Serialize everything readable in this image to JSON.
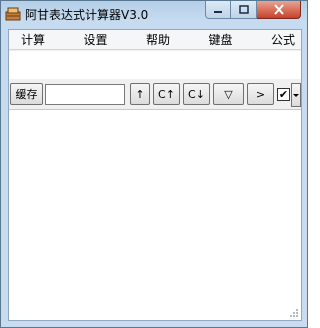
{
  "window": {
    "title": "阿甘表达式计算器V3.0",
    "icons": {
      "app": "abacus-icon",
      "minimize": "minimize-icon",
      "maximize": "maximize-icon",
      "close": "close-icon"
    }
  },
  "menu": [
    "计算",
    "设置",
    "帮助",
    "键盘",
    "公式"
  ],
  "toolbar": {
    "cache_label": "缓存",
    "cache_value": "",
    "up_label": "↑",
    "c_up_label": "C↑",
    "c_down_label": "C↓",
    "expand_label": "▽",
    "next_label": ">",
    "checkbox_checked": true,
    "checkbox_mark": "✔"
  },
  "colors": {
    "titlebar": "#c6dbef",
    "close_button": "#c7412a",
    "client_bg": "#f0f0f0"
  }
}
